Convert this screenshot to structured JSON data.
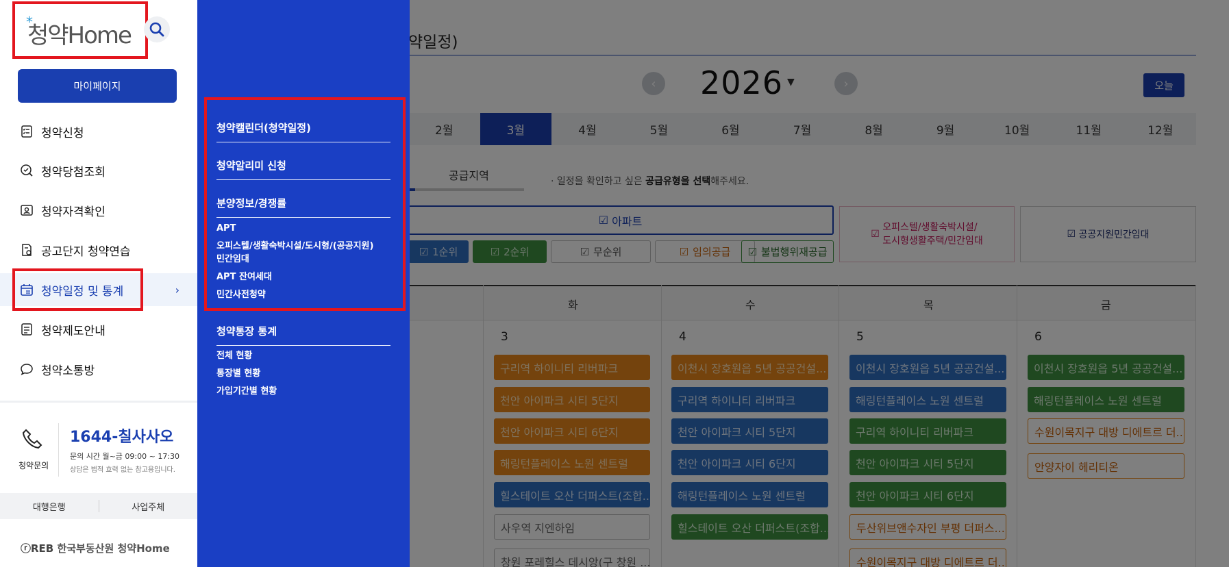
{
  "background": {
    "page_title": "약일정)",
    "year": "2026",
    "today_label": "오늘",
    "months": [
      "2월",
      "3월",
      "4월",
      "5월",
      "6월",
      "7월",
      "8월",
      "9월",
      "10월",
      "11월",
      "12월"
    ],
    "active_month": "3월",
    "tab_region": "공급지역",
    "guide_prefix": "· 일정을 확인하고 싶은 ",
    "guide_bold": "공급유형을 선택",
    "guide_suffix": "해주세요.",
    "type_apt": "아파트",
    "type_officetel_line1": "오피스텔/생활숙박시설/",
    "type_officetel_line2": "도시형생활주택/민간임대",
    "type_public": "공공지원민간임대",
    "sub_filters": [
      "1순위",
      "2순위",
      "무순위",
      "임의공급",
      "불법행위재공급"
    ],
    "day_names": [
      "화",
      "수",
      "목",
      "금"
    ],
    "dates": [
      "3",
      "4",
      "5",
      "6"
    ],
    "col_tue": [
      "구리역 하이니티 리버파크",
      "천안 아이파크 시티 5단지",
      "천안 아이파크 시티 6단지",
      "해링턴플레이스 노원 센트럴",
      "힐스테이트 오산 더퍼스트(조합...",
      "사우역 지엔하임",
      "창원 포레힐스 데시앙(구 창원 ..."
    ],
    "col_wed": [
      "이천시 장호원읍 5년 공공건설...",
      "구리역 하이니티 리버파크",
      "천안 아이파크 시티 5단지",
      "천안 아이파크 시티 6단지",
      "해링턴플레이스 노원 센트럴",
      "힐스테이트 오산 더퍼스트(조합..."
    ],
    "col_thu": [
      "이천시 장호원읍 5년 공공건설...",
      "해링턴플레이스 노원 센트럴",
      "구리역 하이니티 리버파크",
      "천안 아이파크 시티 5단지",
      "천안 아이파크 시티 6단지",
      "두산위브앤수자인 부평 더퍼스...",
      "수원이목지구 대방 디에트르 더..."
    ],
    "col_fri": [
      "이천시 장호원읍 5년 공공건설...",
      "해링턴플레이스 노원 센트럴",
      "수원이목지구 대방 디에트르 더...",
      "안양자이 헤리티온"
    ]
  },
  "sidebar": {
    "logo": "청약Home",
    "mypage": "마이페이지",
    "items": [
      {
        "label": "청약신청",
        "icon": "form-icon"
      },
      {
        "label": "청약당첨조회",
        "icon": "check-search-icon"
      },
      {
        "label": "청약자격확인",
        "icon": "id-card-icon"
      },
      {
        "label": "공고단지 청약연습",
        "icon": "practice-icon"
      },
      {
        "label": "청약일정 및 통계",
        "icon": "calendar-icon"
      },
      {
        "label": "청약제도안내",
        "icon": "document-icon"
      },
      {
        "label": "청약소통방",
        "icon": "chat-icon"
      }
    ],
    "phone_label": "청약문의",
    "phone_number": "1644-칠사사오",
    "phone_hours": "문의 시간 월~금 09:00 ~ 17:30",
    "phone_note": "상담은 법적 효력 없는 참고용입니다.",
    "bank": "대행은행",
    "business": "사업주체",
    "footer": "한국부동산원 청약Home"
  },
  "submenu": {
    "head1": "청약캘린더(청약일정)",
    "head2": "청약알리미 신청",
    "head3": "분양정보/경쟁률",
    "items3": [
      "APT",
      "오피스텔/생활숙박시설/도시형/(공공지원)",
      "민간임대",
      "APT 잔여세대",
      "민간사전청약"
    ],
    "head4": "청약통장 통계",
    "items4": [
      "전체 현황",
      "통장별 현황",
      "가입기간별 현황"
    ]
  }
}
